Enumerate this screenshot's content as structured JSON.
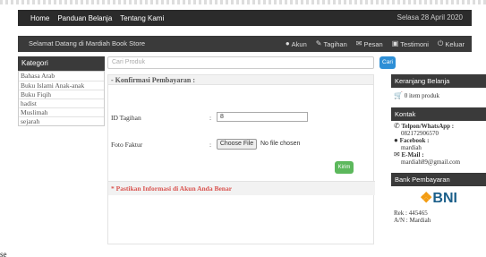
{
  "nav": {
    "links": [
      "Home",
      "Panduan Belanja",
      "Tentang Kami"
    ],
    "date": "Selasa 28 April 2020"
  },
  "subnav": {
    "welcome": "Selamat Datang di Mardiah Book Store",
    "menu": [
      {
        "label": "Akun",
        "icon": "user-icon"
      },
      {
        "label": "Tagihan",
        "icon": "edit-icon"
      },
      {
        "label": "Pesan",
        "icon": "mail-icon"
      },
      {
        "label": "Testimoni",
        "icon": "comment-icon"
      },
      {
        "label": "Keluar",
        "icon": "logout-icon"
      }
    ]
  },
  "sidebar": {
    "title": "Kategori",
    "items": [
      "Bahasa Arab",
      "Buku Islami Anak-anak",
      "Buku Fiqih",
      "hadist",
      "Muslimah",
      "sejarah"
    ]
  },
  "search": {
    "placeholder": "Cari Produk",
    "button": "Cari"
  },
  "konfirmasi": {
    "title": "- Konfirmasi Pembayaran :",
    "id_label": "ID Tagihan",
    "id_value": "8",
    "faktur_label": "Foto Faktur",
    "colon": ":",
    "file_button": "Choose File",
    "file_status": "No file chosen",
    "submit": "Kirim",
    "note": "* Pastikan Informasi di Akun Anda Benar"
  },
  "cart": {
    "title": "Keranjang Belanja",
    "items": "0 item produk",
    "icon": "cart-icon"
  },
  "kontak": {
    "title": "Kontak",
    "phone_label": "Telpon/WhatsApp :",
    "phone": "082172906570",
    "facebook_label": "Facebook :",
    "facebook": "mardiah",
    "email_label": "E-Mail :",
    "email": "mardiah89@gmail.com"
  },
  "bank": {
    "title": "Bank Pembayaran",
    "logo_text": "BNI",
    "rek": "Rek : 445465",
    "an": "A/N : Mardiah"
  },
  "footer_fragment": "se",
  "colors": {
    "dark_bar": "#2b2b2b",
    "search_btn": "#2e8fd6",
    "kirim_btn": "#5cb85c",
    "note_red": "#d9534f",
    "bni_blue": "#1b5f8a",
    "bni_orange": "#f39c12"
  }
}
